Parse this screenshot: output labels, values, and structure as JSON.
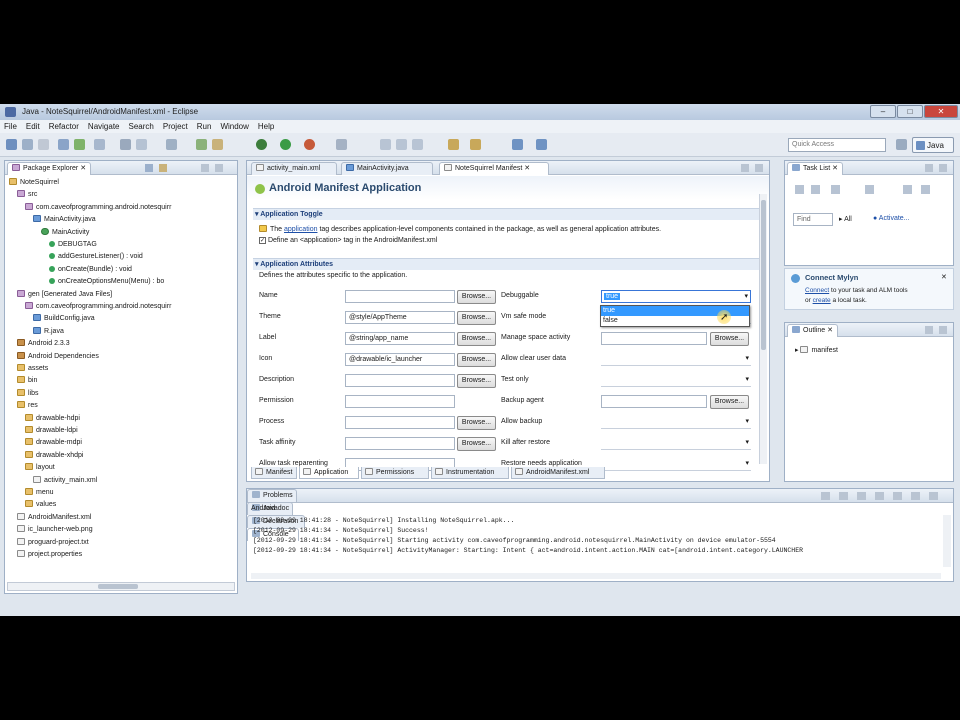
{
  "window": {
    "title": "Java - NoteSquirrel/AndroidManifest.xml - Eclipse",
    "min": "–",
    "max": "□",
    "close": "✕"
  },
  "menu": [
    "File",
    "Edit",
    "Refactor",
    "Navigate",
    "Search",
    "Project",
    "Run",
    "Window",
    "Help"
  ],
  "toolbar": {
    "quick_access": "Quick Access",
    "perspective": "Java"
  },
  "package_explorer": {
    "tab": "Package Explorer",
    "tree": [
      {
        "label": "NoteSquirrel",
        "icon": "folder"
      },
      {
        "label": "src",
        "icon": "pkg"
      },
      {
        "label": "com.caveofprogramming.android.notesquirr",
        "icon": "pkg"
      },
      {
        "label": "MainActivity.java",
        "icon": "jfile"
      },
      {
        "label": "MainActivity",
        "icon": "cls"
      },
      {
        "label": "DEBUGTAG",
        "icon": "meth"
      },
      {
        "label": "addGestureListener() : void",
        "icon": "meth"
      },
      {
        "label": "onCreate(Bundle) : void",
        "icon": "meth"
      },
      {
        "label": "onCreateOptionsMenu(Menu) : bo",
        "icon": "meth"
      },
      {
        "label": "gen [Generated Java Files]",
        "icon": "pkg"
      },
      {
        "label": "com.caveofprogramming.android.notesquirr",
        "icon": "pkg"
      },
      {
        "label": "BuildConfig.java",
        "icon": "jfile"
      },
      {
        "label": "R.java",
        "icon": "jfile"
      },
      {
        "label": "Android 2.3.3",
        "icon": "lib"
      },
      {
        "label": "Android Dependencies",
        "icon": "lib"
      },
      {
        "label": "assets",
        "icon": "folder"
      },
      {
        "label": "bin",
        "icon": "folder"
      },
      {
        "label": "libs",
        "icon": "folder"
      },
      {
        "label": "res",
        "icon": "folder"
      },
      {
        "label": "drawable-hdpi",
        "icon": "folder"
      },
      {
        "label": "drawable-ldpi",
        "icon": "folder"
      },
      {
        "label": "drawable-mdpi",
        "icon": "folder"
      },
      {
        "label": "drawable-xhdpi",
        "icon": "folder"
      },
      {
        "label": "layout",
        "icon": "folder"
      },
      {
        "label": "activity_main.xml",
        "icon": "file"
      },
      {
        "label": "menu",
        "icon": "folder"
      },
      {
        "label": "values",
        "icon": "folder"
      },
      {
        "label": "AndroidManifest.xml",
        "icon": "file"
      },
      {
        "label": "ic_launcher-web.png",
        "icon": "file"
      },
      {
        "label": "proguard-project.txt",
        "icon": "file"
      },
      {
        "label": "project.properties",
        "icon": "file"
      }
    ]
  },
  "editor": {
    "tabs": [
      "activity_main.xml",
      "MainActivity.java",
      "NoteSquirrel Manifest"
    ],
    "heading": "Android Manifest Application",
    "toggle_section": "Application Toggle",
    "toggle_desc_pre": "The",
    "toggle_desc_link": "application",
    "toggle_desc_post": "tag describes application-level components contained in the package, as well as general application attributes.",
    "define_check": "Define an <application> tag in the AndroidManifest.xml",
    "attributes_section": "Application Attributes",
    "attributes_desc": "Defines the attributes specific to the application.",
    "browse": "Browse...",
    "left_fields": [
      {
        "label": "Name",
        "value": ""
      },
      {
        "label": "Theme",
        "value": "@style/AppTheme"
      },
      {
        "label": "Label",
        "value": "@string/app_name"
      },
      {
        "label": "Icon",
        "value": "@drawable/ic_launcher"
      },
      {
        "label": "Description",
        "value": ""
      },
      {
        "label": "Permission",
        "value": ""
      },
      {
        "label": "Process",
        "value": ""
      },
      {
        "label": "Task affinity",
        "value": ""
      },
      {
        "label": "Allow task reparenting",
        "value": ""
      }
    ],
    "right_fields": [
      {
        "label": "Debuggable",
        "value": "true"
      },
      {
        "label": "Vm safe mode",
        "value": ""
      },
      {
        "label": "Manage space activity",
        "value": ""
      },
      {
        "label": "Allow clear user data",
        "value": ""
      },
      {
        "label": "Test only",
        "value": ""
      },
      {
        "label": "Backup agent",
        "value": ""
      },
      {
        "label": "Allow backup",
        "value": ""
      },
      {
        "label": "Kill after restore",
        "value": ""
      },
      {
        "label": "Restore needs application",
        "value": ""
      }
    ],
    "dropdown_options": [
      "true",
      "false"
    ],
    "bottom_tabs": [
      "Manifest",
      "Application",
      "Permissions",
      "Instrumentation",
      "AndroidManifest.xml"
    ]
  },
  "task_list": {
    "tab": "Task List",
    "find_placeholder": "Find",
    "all": "All",
    "activate": "Activate..."
  },
  "mylyn": {
    "title": "Connect Mylyn",
    "line1_link": "Connect",
    "line1_rest": "to your task and ALM tools",
    "line2_pre": "or",
    "line2_link": "create",
    "line2_rest": "a local task."
  },
  "outline": {
    "tab": "Outline",
    "item": "manifest"
  },
  "console": {
    "tabs": [
      "Problems",
      "Javadoc",
      "Declaration",
      "Console"
    ],
    "label": "Android",
    "lines": [
      "[2012-09-29 18:41:28 - NoteSquirrel] Installing NoteSquirrel.apk...",
      "[2012-09-29 18:41:34 - NoteSquirrel] Success!",
      "[2012-09-29 18:41:34 - NoteSquirrel] Starting activity com.caveofprogramming.android.notesquirrel.MainActivity on device emulator-5554",
      "[2012-09-29 18:41:34 - NoteSquirrel] ActivityManager: Starting: Intent { act=android.intent.action.MAIN cat=[android.intent.category.LAUNCHER"
    ]
  },
  "colors": {
    "accent": "#3875d7",
    "selection": "#3399ff"
  }
}
